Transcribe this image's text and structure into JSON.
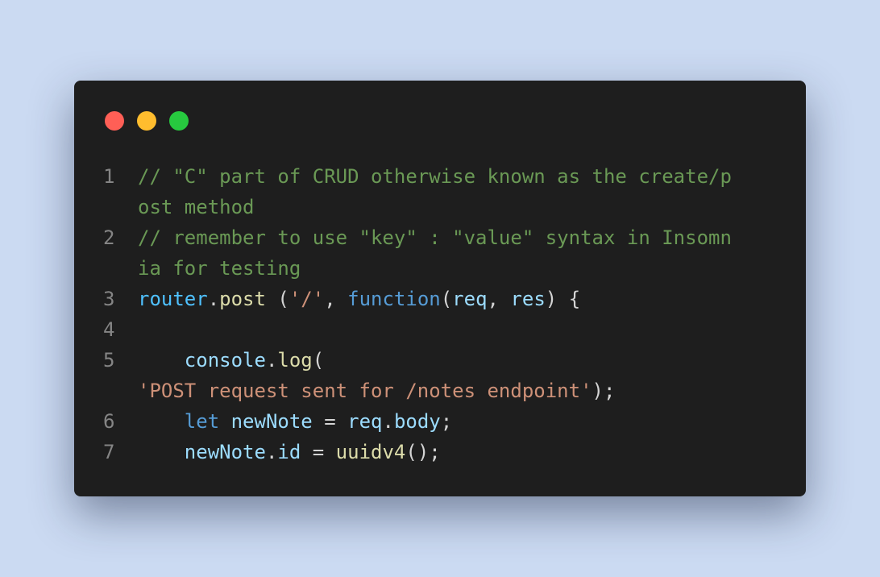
{
  "window_controls": {
    "close_color": "#ff5f56",
    "minimize_color": "#ffbd2e",
    "maximize_color": "#27c93f"
  },
  "colors": {
    "background": "#cbdaf2",
    "editor": "#1e1e1e",
    "comment": "#6a9955",
    "string": "#ce9178",
    "keyword": "#569cd6",
    "function": "#dcdcaa",
    "variable": "#9cdcfe"
  },
  "code": {
    "line_numbers": [
      "1",
      "2",
      "3",
      "4",
      "5",
      "6",
      "7"
    ],
    "line1_a": "// \"C\" part of CRUD otherwise known as the create/p",
    "line1_b": "ost method",
    "line2_a": "// remember to use \"key\" : \"value\" syntax in Insomn",
    "line2_b": "ia for testing",
    "line3": {
      "router": "router",
      "dot": ".",
      "post": "post",
      "open": " (",
      "path": "'/'",
      "comma": ", ",
      "function_kw": "function",
      "paren": "(",
      "req": "req",
      "sep": ", ",
      "res": "res",
      "close": ") {"
    },
    "line5": {
      "indent": "    ",
      "console": "console",
      "dot": ".",
      "log": "log",
      "open": "(",
      "message": "'POST request sent for /notes endpoint'",
      "close": ");"
    },
    "line6": {
      "indent": "    ",
      "let": "let",
      "space": " ",
      "newNote": "newNote",
      "eq": " = ",
      "req": "req",
      "dot": ".",
      "body": "body",
      "semi": ";"
    },
    "line7": {
      "indent": "    ",
      "newNote": "newNote",
      "dot": ".",
      "id": "id",
      "eq": " = ",
      "uuidv4": "uuidv4",
      "call": "();"
    }
  }
}
